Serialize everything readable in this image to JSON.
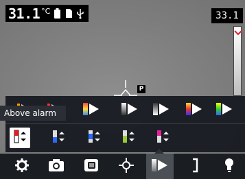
{
  "status": {
    "spot_temperature": "31.1",
    "temperature_unit": "°C",
    "scale_max": "33.1",
    "measure_badge": "P",
    "icons": [
      "battery-icon",
      "sd-card-icon",
      "usb-icon"
    ]
  },
  "palette_menu": {
    "tooltip": "Above alarm",
    "row1": [
      {
        "name": "palette-iron",
        "icon": "palette-iron-icon"
      },
      {
        "name": "palette-rainbow",
        "icon": "palette-rainbow-icon"
      },
      {
        "name": "palette-rainbow-hc",
        "icon": "palette-rainbow-hc-icon"
      },
      {
        "name": "palette-white-hot",
        "icon": "palette-white-hot-icon"
      },
      {
        "name": "palette-black-hot",
        "icon": "palette-black-hot-icon"
      },
      {
        "name": "palette-arctic",
        "icon": "palette-arctic-icon"
      },
      {
        "name": "palette-lava",
        "icon": "palette-lava-icon"
      },
      {
        "name": "palette-medical",
        "icon": "palette-medical-icon"
      }
    ],
    "row2": [
      {
        "name": "alarm-above",
        "icon": "alarm-above-icon",
        "selected": true
      },
      {
        "name": "alarm-below",
        "icon": "alarm-below-icon"
      },
      {
        "name": "alarm-interval",
        "icon": "alarm-interval-icon"
      },
      {
        "name": "alarm-condensation",
        "icon": "alarm-condensation-icon"
      },
      {
        "name": "alarm-insulation",
        "icon": "alarm-insulation-icon"
      }
    ]
  },
  "bottom_menu": [
    {
      "name": "settings",
      "icon": "gear-icon"
    },
    {
      "name": "camera",
      "icon": "camera-icon"
    },
    {
      "name": "image-mode",
      "icon": "image-mode-icon"
    },
    {
      "name": "measurement",
      "icon": "crosshair-icon"
    },
    {
      "name": "color",
      "icon": "palette-icon",
      "active": true
    },
    {
      "name": "temperature-scale",
      "icon": "scale-bracket-icon"
    },
    {
      "name": "light",
      "icon": "bulb-icon"
    }
  ],
  "colors": {
    "panel": "#14181e",
    "accent_white": "#ffffff",
    "alarm_red": "#e11d26",
    "bar_bg": "#1a1d22"
  }
}
